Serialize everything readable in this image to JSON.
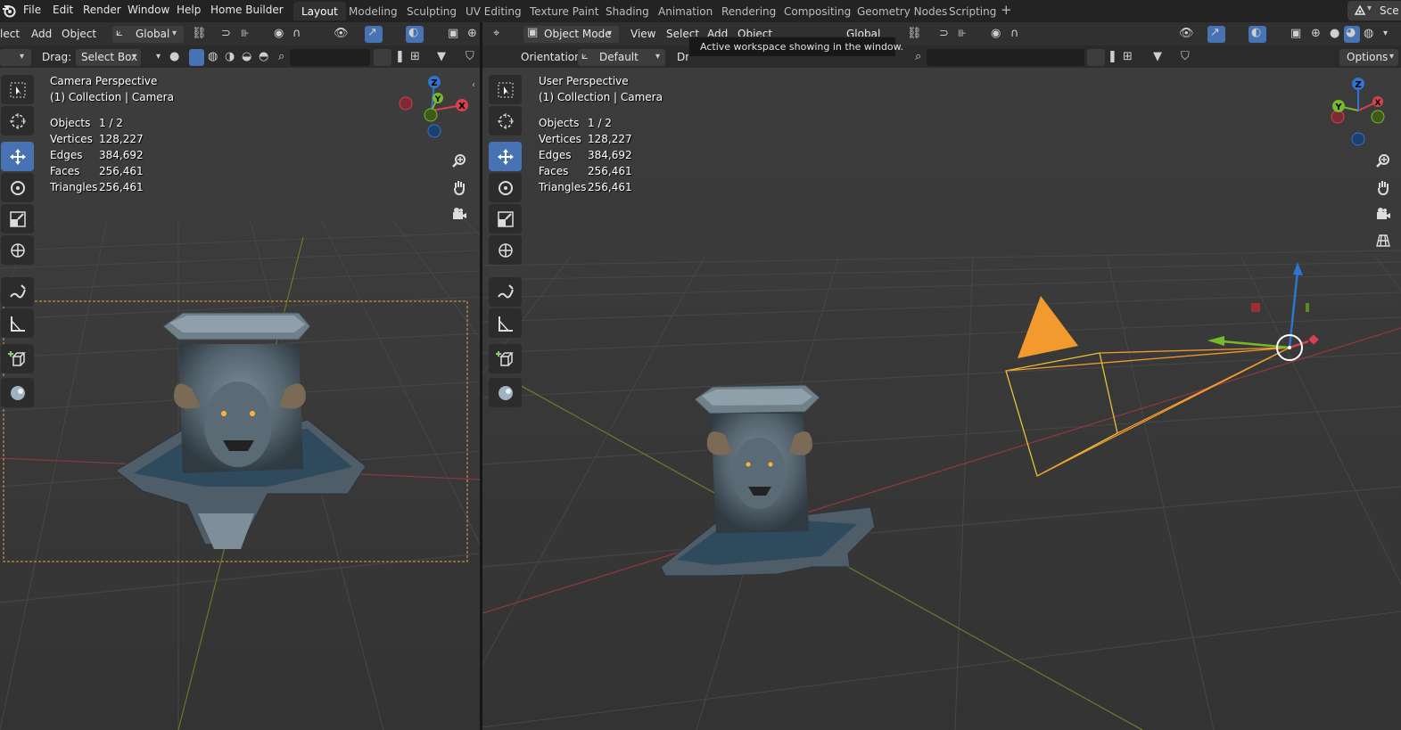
{
  "menubar": {
    "items": [
      "File",
      "Edit",
      "Render",
      "Window",
      "Help",
      "Home Builder"
    ],
    "workspaces": [
      "Layout",
      "Modeling",
      "Sculpting",
      "UV Editing",
      "Texture Paint",
      "Shading",
      "Animation",
      "Rendering",
      "Compositing",
      "Geometry Nodes",
      "Scripting"
    ],
    "active_workspace": "Layout",
    "scene_label": "Sce"
  },
  "left_header": {
    "select_cut": "lect",
    "add": "Add",
    "object": "Object",
    "transform_orientation": "Global",
    "drag_label": "Drag:",
    "drag_value": "Select Box"
  },
  "right_header": {
    "mode": "Object Mode",
    "view": "View",
    "select": "Select",
    "add": "Add",
    "object": "Object",
    "transform_orientation": "Global",
    "orientation_label": "Orientation:",
    "orientation_value": "Default",
    "drag_cut": "Dr",
    "options": "Options"
  },
  "tooltip": "Active workspace showing in the window.",
  "left_viewport": {
    "title": "Camera Perspective",
    "collection": "(1) Collection | Camera",
    "stats": [
      {
        "label": "Objects",
        "value": "1 / 2"
      },
      {
        "label": "Vertices",
        "value": "128,227"
      },
      {
        "label": "Edges",
        "value": "384,692"
      },
      {
        "label": "Faces",
        "value": "256,461"
      },
      {
        "label": "Triangles",
        "value": "256,461"
      }
    ]
  },
  "right_viewport": {
    "title": "User Perspective",
    "collection": "(1) Collection | Camera",
    "stats": [
      {
        "label": "Objects",
        "value": "1 / 2"
      },
      {
        "label": "Vertices",
        "value": "128,227"
      },
      {
        "label": "Edges",
        "value": "384,692"
      },
      {
        "label": "Faces",
        "value": "256,461"
      },
      {
        "label": "Triangles",
        "value": "256,461"
      }
    ]
  },
  "gizmo_axes": {
    "x": "X",
    "y": "Y",
    "z": "Z"
  },
  "colors": {
    "accent": "#4772b3",
    "x_axis": "#d9404f",
    "y_axis": "#78b92c",
    "z_axis": "#2f74d0",
    "selection": "#f29a2e"
  },
  "tools": [
    "select-box-icon",
    "cursor-icon",
    "move-icon",
    "rotate-icon",
    "scale-icon",
    "transform-icon",
    "annotate-icon",
    "measure-icon",
    "add-cube-icon",
    "editor-icon"
  ]
}
